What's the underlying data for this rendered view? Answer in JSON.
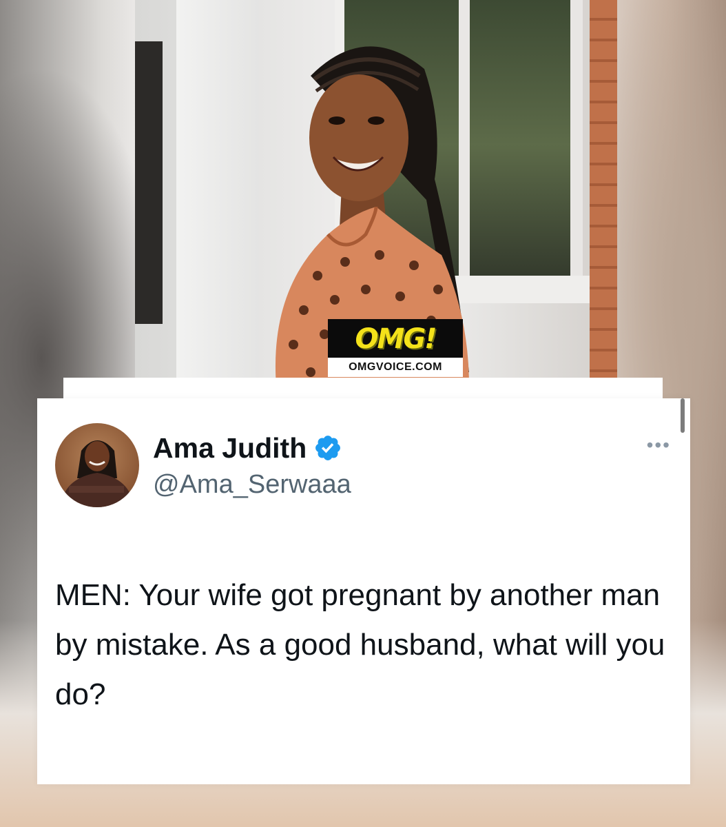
{
  "photo_logo": {
    "brand": "OMG!",
    "site": "OMGVOICE.COM"
  },
  "tweet": {
    "display_name": "Ama Judith",
    "handle": "@Ama_Serwaaa",
    "verified": true,
    "text": "MEN: Your wife got pregnant by another man by mistake. As a good husband, what will you do?",
    "more_label": "•••"
  },
  "colors": {
    "verified_badge": "#1d9bf0",
    "text_primary": "#0f1419",
    "text_secondary": "#536471",
    "logo_yellow": "#f4e21a"
  },
  "icons": {
    "verified": "verified-badge-icon",
    "more": "more-options-icon"
  }
}
